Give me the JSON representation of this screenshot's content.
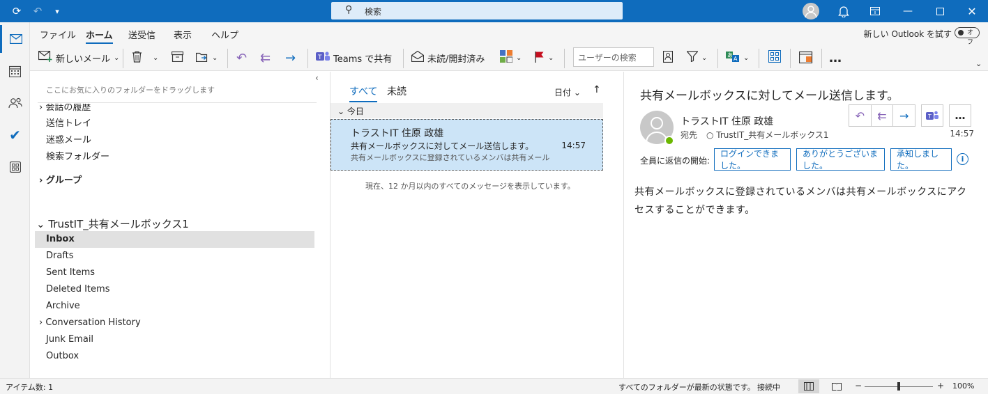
{
  "titlebar": {
    "search_label": "検索",
    "icons": [
      "sync-icon",
      "undo-icon",
      "quick-access-dropdown-icon",
      "search-icon",
      "account-avatar-icon",
      "bell-icon",
      "ribbon-display-icon",
      "minimize-icon",
      "maximize-icon",
      "close-icon"
    ]
  },
  "rail": {
    "items": [
      "mail",
      "calendar",
      "people",
      "todo",
      "apps"
    ]
  },
  "ribbon": {
    "tabs": [
      "ファイル",
      "ホーム",
      "送受信",
      "表示",
      "ヘルプ"
    ],
    "active_tab": "ホーム",
    "try_new_outlook": "新しい Outlook を試す",
    "toggle_label": "オフ",
    "new_mail": "新しいメール",
    "teams_share": "Teams で共有",
    "unread_read": "未読/開封済み",
    "user_search_placeholder": "ユーザーの検索",
    "more": "…"
  },
  "folders": {
    "favorites_hint": "ここにお気に入りのフォルダーをドラッグします",
    "top_items": [
      "会話の履歴",
      "送信トレイ",
      "迷惑メール",
      "検索フォルダー"
    ],
    "group_label": "グループ",
    "account": "TrustIT_共有メールボックス1",
    "items": [
      "Inbox",
      "Drafts",
      "Sent Items",
      "Deleted Items",
      "Archive",
      "Conversation History",
      "Junk Email",
      "Outbox"
    ],
    "selected": "Inbox"
  },
  "message_list": {
    "tab_all": "すべて",
    "tab_unread": "未読",
    "sort_label": "日付",
    "group_today": "今日",
    "messages": [
      {
        "from": "トラストIT 住原 政雄",
        "subject": "共有メールボックスに対してメール送信します。",
        "time": "14:57",
        "preview": "共有メールボックスに登録されているメンバは共有メール"
      }
    ],
    "footer_note": "現在、12 か月以内のすべてのメッセージを表示しています。"
  },
  "reading": {
    "subject": "共有メールボックスに対してメール送信します。",
    "from": "トラストIT 住原 政雄",
    "to_label": "宛先",
    "to": "TrustIT_共有メールボックス1",
    "time": "14:57",
    "quick_reply_label": "全員に返信の開始:",
    "quick_replies": [
      "ログインできました。",
      "ありがとうございました。",
      "承知しました。"
    ],
    "body": "共有メールボックスに登録されているメンバは共有メールボックスにアクセスすることができます。"
  },
  "status": {
    "item_count": "アイテム数: 1",
    "folders_status": "すべてのフォルダーが最新の状態です。",
    "connection": "接続中",
    "zoom_minus": "−",
    "zoom_plus": "+",
    "zoom": "100%",
    "zoom_level_percent": 100
  }
}
